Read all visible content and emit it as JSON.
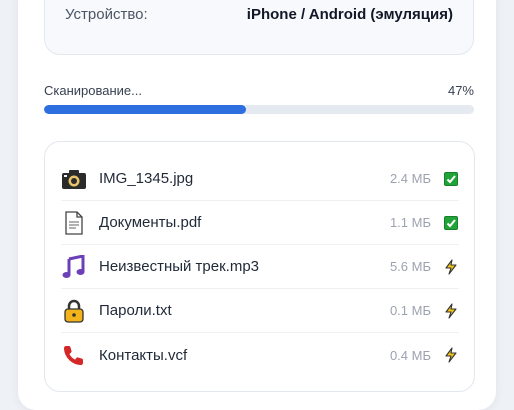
{
  "device": {
    "label": "Устройство:",
    "value": "iPhone / Android (эмуляция)"
  },
  "scan": {
    "label": "Сканирование...",
    "percent_label": "47%",
    "progress": 0.47
  },
  "files": [
    {
      "name": "IMG_1345.jpg",
      "size": "2.4 МБ",
      "icon": "camera-icon",
      "status": "done"
    },
    {
      "name": "Документы.pdf",
      "size": "1.1 МБ",
      "icon": "document-icon",
      "status": "done"
    },
    {
      "name": "Неизвестный трек.mp3",
      "size": "5.6 МБ",
      "icon": "music-note-icon",
      "status": "processing"
    },
    {
      "name": "Пароли.txt",
      "size": "0.1 МБ",
      "icon": "lock-icon",
      "status": "processing"
    },
    {
      "name": "Контакты.vcf",
      "size": "0.4 МБ",
      "icon": "phone-icon",
      "status": "processing"
    }
  ],
  "colors": {
    "accent": "#2e6fe0",
    "done": "#22a33a",
    "processing": "#e0a800"
  }
}
